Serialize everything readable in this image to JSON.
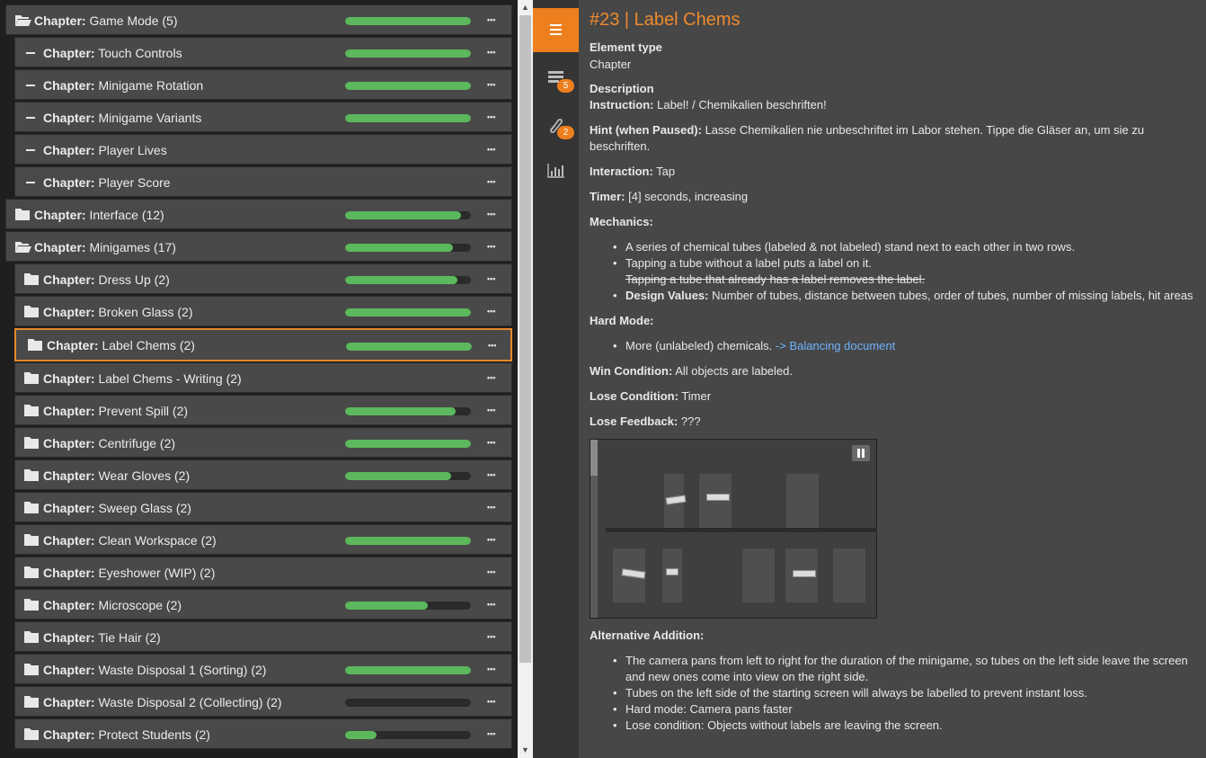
{
  "tree": {
    "rows": [
      {
        "prefix": "Chapter:",
        "name": "Game Mode (5)",
        "icon": "folder-open-icon",
        "progress": 1.0
      },
      {
        "prefix": "Chapter:",
        "name": "Touch Controls",
        "icon": "dash-icon",
        "progress": 1.0
      },
      {
        "prefix": "Chapter:",
        "name": "Minigame Rotation",
        "icon": "dash-icon",
        "progress": 1.0
      },
      {
        "prefix": "Chapter:",
        "name": "Minigame Variants",
        "icon": "dash-icon",
        "progress": 1.0
      },
      {
        "prefix": "Chapter:",
        "name": "Player Lives",
        "icon": "dash-icon",
        "progress": null
      },
      {
        "prefix": "Chapter:",
        "name": "Player Score",
        "icon": "dash-icon",
        "progress": null
      },
      {
        "prefix": "Chapter:",
        "name": "Interface (12)",
        "icon": "folder-icon",
        "progress": 0.92
      },
      {
        "prefix": "Chapter:",
        "name": "Minigames (17)",
        "icon": "folder-open-icon",
        "progress": 0.86
      },
      {
        "prefix": "Chapter:",
        "name": "Dress Up (2)",
        "icon": "folder-icon",
        "progress": 0.89
      },
      {
        "prefix": "Chapter:",
        "name": "Broken Glass (2)",
        "icon": "folder-icon",
        "progress": 1.0
      },
      {
        "prefix": "Chapter:",
        "name": "Label Chems (2)",
        "icon": "folder-icon",
        "progress": 1.0
      },
      {
        "prefix": "Chapter:",
        "name": "Label Chems - Writing (2)",
        "icon": "folder-icon",
        "progress": null
      },
      {
        "prefix": "Chapter:",
        "name": "Prevent Spill (2)",
        "icon": "folder-icon",
        "progress": 0.88
      },
      {
        "prefix": "Chapter:",
        "name": "Centrifuge (2)",
        "icon": "folder-icon",
        "progress": 1.0
      },
      {
        "prefix": "Chapter:",
        "name": "Wear Gloves (2)",
        "icon": "folder-icon",
        "progress": 0.84
      },
      {
        "prefix": "Chapter:",
        "name": "Sweep Glass (2)",
        "icon": "folder-icon",
        "progress": null
      },
      {
        "prefix": "Chapter:",
        "name": "Clean Workspace (2)",
        "icon": "folder-icon",
        "progress": 1.0
      },
      {
        "prefix": "Chapter:",
        "name": "Eyeshower (WIP) (2)",
        "icon": "folder-icon",
        "progress": null
      },
      {
        "prefix": "Chapter:",
        "name": "Microscope (2)",
        "icon": "folder-icon",
        "progress": 0.66
      },
      {
        "prefix": "Chapter:",
        "name": "Tie Hair (2)",
        "icon": "folder-icon",
        "progress": null
      },
      {
        "prefix": "Chapter:",
        "name": "Waste Disposal 1 (Sorting) (2)",
        "icon": "folder-icon",
        "progress": 1.0
      },
      {
        "prefix": "Chapter:",
        "name": "Waste Disposal 2 (Collecting) (2)",
        "icon": "folder-icon",
        "progress": 0.0
      },
      {
        "prefix": "Chapter:",
        "name": "Protect Students (2)",
        "icon": "folder-icon",
        "progress": 0.25
      }
    ],
    "progress_color": "#5cb85c",
    "selected_color": "#e8882a"
  },
  "sidebar": {
    "comments_badge": "5",
    "attachments_badge": "2",
    "accent": "#ee7f1e"
  },
  "detail": {
    "title": "#23 | Label Chems",
    "element_type_label": "Element type",
    "element_type_value": "Chapter",
    "description_label": "Description",
    "instruction_label": "Instruction:",
    "instruction_value": " Label! / Chemikalien beschriften!",
    "hint_label": "Hint (when Paused):",
    "hint_value": " Lasse Chemikalien nie unbeschriftet im Labor stehen. Tippe die Gläser an, um sie zu",
    "hint_value_2": "beschriften.",
    "interaction_label": "Interaction:",
    "interaction_value": " Tap",
    "timer_label": "Timer:",
    "timer_value": " [4] seconds, increasing",
    "mechanics_label": "Mechanics:",
    "mech_1": "A series of chemical tubes (labeled & not labeled) stand next to each other in two rows.",
    "mech_2": "Tapping a tube without a label puts a label on it.",
    "mech_2_strike": "Tapping a tube that already has a label removes the label.",
    "mech_3_label": "Design Values:",
    "mech_3_value": " Number of tubes, distance between tubes, order of tubes, number of missing labels, hit areas",
    "hard_label": "Hard Mode:",
    "hard_1": "More (unlabeled) chemicals. ",
    "hard_link": "-> Balancing document",
    "win_label": "Win Condition:",
    "win_value": " All objects are labeled.",
    "lose_label": "Lose Condition:",
    "lose_value": " Timer",
    "lose_fb_label": "Lose Feedback:",
    "lose_fb_value": " ???",
    "alt_label": "Alternative Addition:",
    "alt_1": "The camera pans from left to right for the duration of the minigame, so tubes on the left side leave the screen",
    "alt_1b": "and new ones come into view on the right side.",
    "alt_2": "Tubes on the left side of the starting screen will always be labelled to prevent instant loss.",
    "alt_3": "Hard mode: Camera pans faster",
    "alt_4": "Lose condition: Objects without labels are leaving the screen.",
    "title_color": "#ee8a2c",
    "link_color": "#6fb2ff"
  }
}
